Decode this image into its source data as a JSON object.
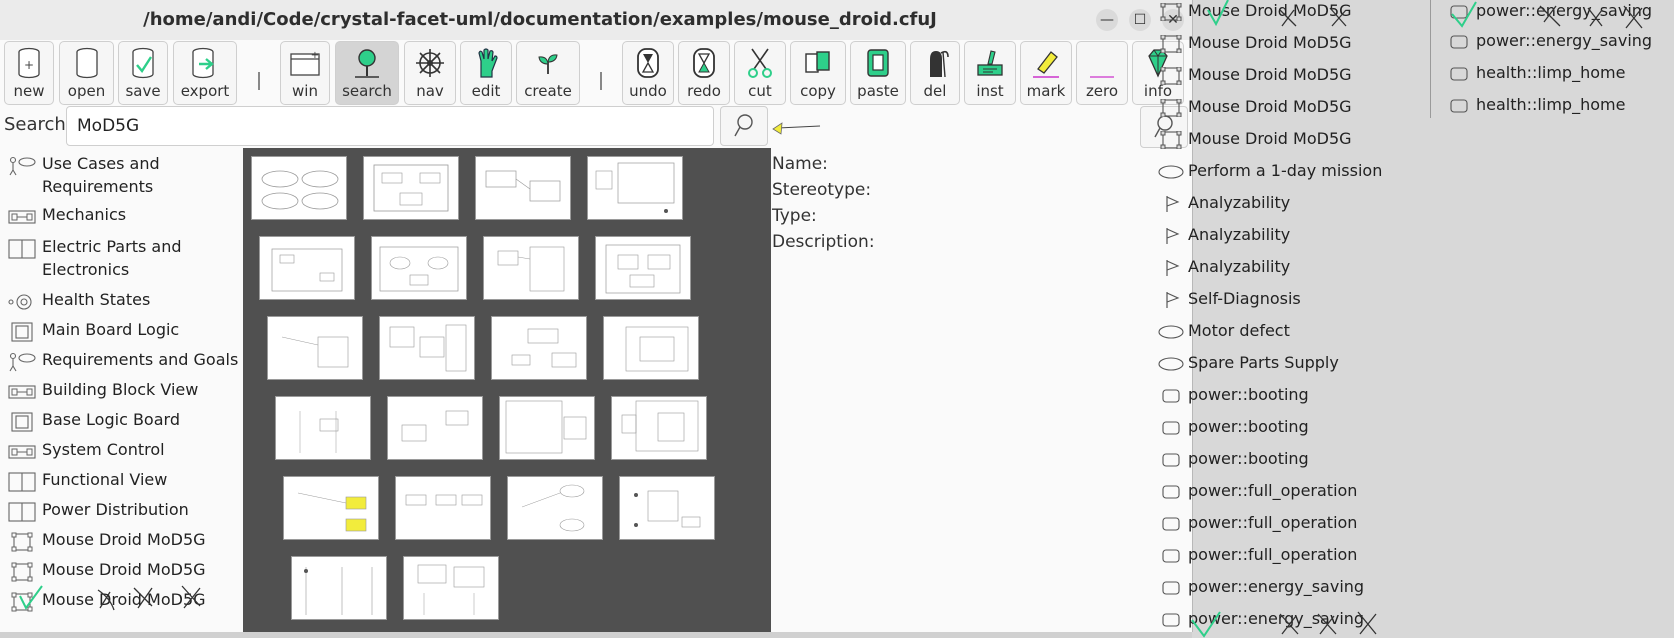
{
  "window": {
    "title": "/home/andi/Code/crystal-facet-uml/documentation/examples/mouse_droid.cfuJ",
    "controls": {
      "minimize": "—",
      "maximize": "☐",
      "close": "✕"
    }
  },
  "toolbar": {
    "buttons": [
      {
        "label": "new",
        "icon": "new-file-icon"
      },
      {
        "label": "open",
        "icon": "open-file-icon"
      },
      {
        "label": "save",
        "icon": "save-icon"
      },
      {
        "label": "export",
        "icon": "export-icon"
      },
      {
        "label": "win",
        "icon": "new-window-icon"
      },
      {
        "label": "search",
        "icon": "search-tool-icon",
        "active": true
      },
      {
        "label": "nav",
        "icon": "navigate-wheel-icon"
      },
      {
        "label": "edit",
        "icon": "edit-hand-icon"
      },
      {
        "label": "create",
        "icon": "create-sprout-icon"
      },
      {
        "label": "undo",
        "icon": "undo-hourglass-icon"
      },
      {
        "label": "redo",
        "icon": "redo-hourglass-icon"
      },
      {
        "label": "cut",
        "icon": "scissors-icon"
      },
      {
        "label": "copy",
        "icon": "copy-icon"
      },
      {
        "label": "paste",
        "icon": "paste-icon"
      },
      {
        "label": "del",
        "icon": "delete-reaper-icon"
      },
      {
        "label": "inst",
        "icon": "instantiate-icon"
      },
      {
        "label": "mark",
        "icon": "highlighter-icon"
      },
      {
        "label": "zero",
        "icon": "reset-icon"
      },
      {
        "label": "info",
        "icon": "info-gem-icon"
      }
    ]
  },
  "search": {
    "label": "Search:",
    "value": "MoD5G"
  },
  "tree": {
    "items": [
      {
        "label": "Use Cases and Requirements",
        "icon": "use-case-diagram-icon"
      },
      {
        "label": "Mechanics",
        "icon": "block-diagram-icon"
      },
      {
        "label": "Electric Parts and Electronics",
        "icon": "component-diagram-icon"
      },
      {
        "label": "Health States",
        "icon": "state-diagram-icon"
      },
      {
        "label": "Main Board Logic",
        "icon": "box-diagram-icon"
      },
      {
        "label": "Requirements and Goals",
        "icon": "use-case-diagram-icon"
      },
      {
        "label": "Building Block View",
        "icon": "block-diagram-icon"
      },
      {
        "label": "Base Logic Board",
        "icon": "box-diagram-icon"
      },
      {
        "label": "System Control",
        "icon": "block-diagram-icon"
      },
      {
        "label": "Functional View",
        "icon": "component-diagram-icon"
      },
      {
        "label": "Power Distribution",
        "icon": "component-diagram-icon"
      },
      {
        "label": "Mouse Droid MoD5G",
        "icon": "component-icon"
      },
      {
        "label": "Mouse Droid MoD5G",
        "icon": "component-icon"
      },
      {
        "label": "Mouse Droid MoD5G",
        "icon": "component-icon"
      }
    ]
  },
  "properties": {
    "name_label": "Name:",
    "stereotype_label": "Stereotype:",
    "type_label": "Type:",
    "description_label": "Description:"
  },
  "right_panel": {
    "column1": [
      {
        "label": "Mouse Droid MoD5G",
        "icon": "component-icon"
      },
      {
        "label": "Mouse Droid MoD5G",
        "icon": "component-icon"
      },
      {
        "label": "Mouse Droid MoD5G",
        "icon": "component-icon"
      },
      {
        "label": "Mouse Droid MoD5G",
        "icon": "component-icon"
      },
      {
        "label": "Mouse Droid MoD5G",
        "icon": "component-icon"
      },
      {
        "label": "Perform a 1-day mission",
        "icon": "use-case-ellipse-icon"
      },
      {
        "label": "Analyzability",
        "icon": "requirement-flag-icon"
      },
      {
        "label": "Analyzability",
        "icon": "requirement-flag-icon"
      },
      {
        "label": "Analyzability",
        "icon": "requirement-flag-icon"
      },
      {
        "label": "Self-Diagnosis",
        "icon": "requirement-flag-icon"
      },
      {
        "label": "Motor defect",
        "icon": "use-case-ellipse-icon"
      },
      {
        "label": "Spare Parts Supply",
        "icon": "use-case-ellipse-icon"
      },
      {
        "label": "power::booting",
        "icon": "state-rounded-icon"
      },
      {
        "label": "power::booting",
        "icon": "state-rounded-icon"
      },
      {
        "label": "power::booting",
        "icon": "state-rounded-icon"
      },
      {
        "label": "power::full_operation",
        "icon": "state-rounded-icon"
      },
      {
        "label": "power::full_operation",
        "icon": "state-rounded-icon"
      },
      {
        "label": "power::full_operation",
        "icon": "state-rounded-icon"
      },
      {
        "label": "power::energy_saving",
        "icon": "state-rounded-icon"
      },
      {
        "label": "power::energy_saving",
        "icon": "state-rounded-icon"
      }
    ],
    "column2": [
      {
        "label": "power::energy_saving",
        "icon": "state-rounded-icon"
      },
      {
        "label": "power::energy_saving",
        "icon": "state-rounded-icon"
      },
      {
        "label": "health::limp_home",
        "icon": "state-rounded-icon"
      },
      {
        "label": "health::limp_home",
        "icon": "state-rounded-icon"
      }
    ]
  },
  "colors": {
    "accent_green": "#2ecf8a",
    "gallery_bg": "#505050",
    "side_bg": "#d8d8d8",
    "highlight_yellow": "#f2ec3c"
  }
}
